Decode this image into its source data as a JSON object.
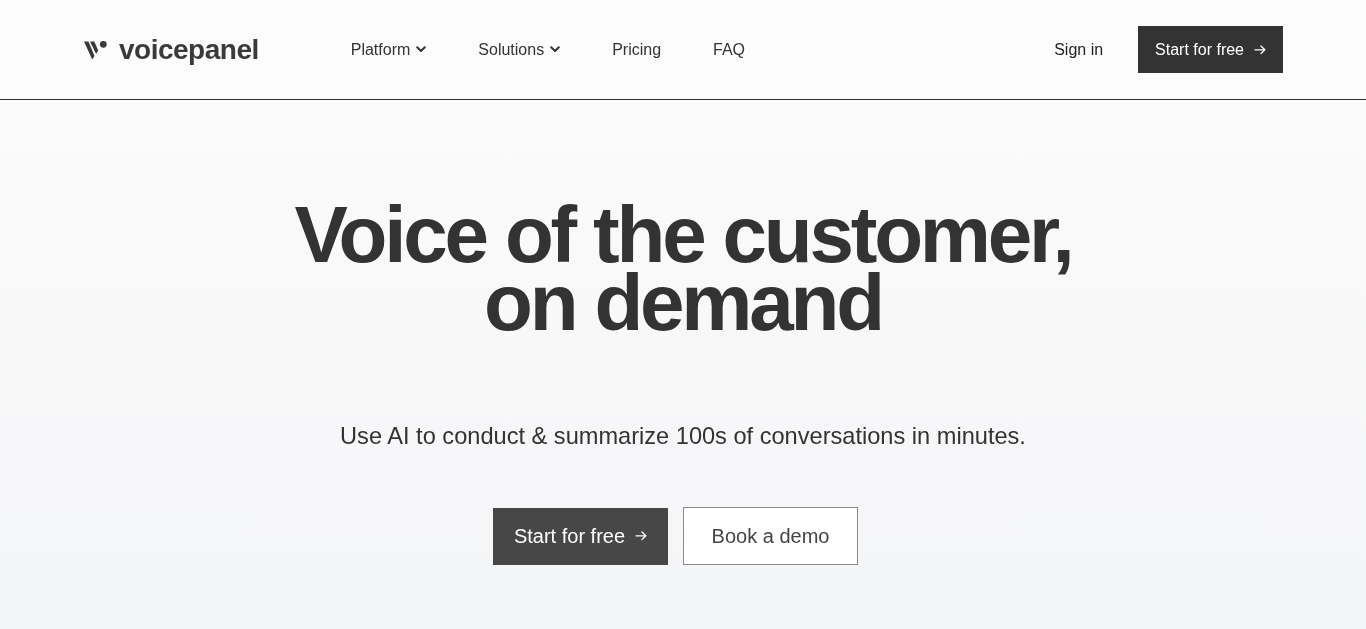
{
  "header": {
    "logo": {
      "text": "voicepanel"
    },
    "nav": [
      {
        "label": "Platform",
        "has_menu": true
      },
      {
        "label": "Solutions",
        "has_menu": true
      },
      {
        "label": "Pricing",
        "has_menu": false
      },
      {
        "label": "FAQ",
        "has_menu": false
      }
    ],
    "sign_in": {
      "label": "Sign in"
    },
    "cta": {
      "label": "Start for free"
    }
  },
  "hero": {
    "title_lines": [
      "Voice of the customer,",
      "on demand"
    ],
    "subtitle": "Use AI to conduct & summarize 100s of conversations in minutes.",
    "buttons": [
      {
        "label": "Start for free",
        "kind": "primary"
      },
      {
        "label": "Book a demo",
        "kind": "secondary"
      }
    ]
  }
}
